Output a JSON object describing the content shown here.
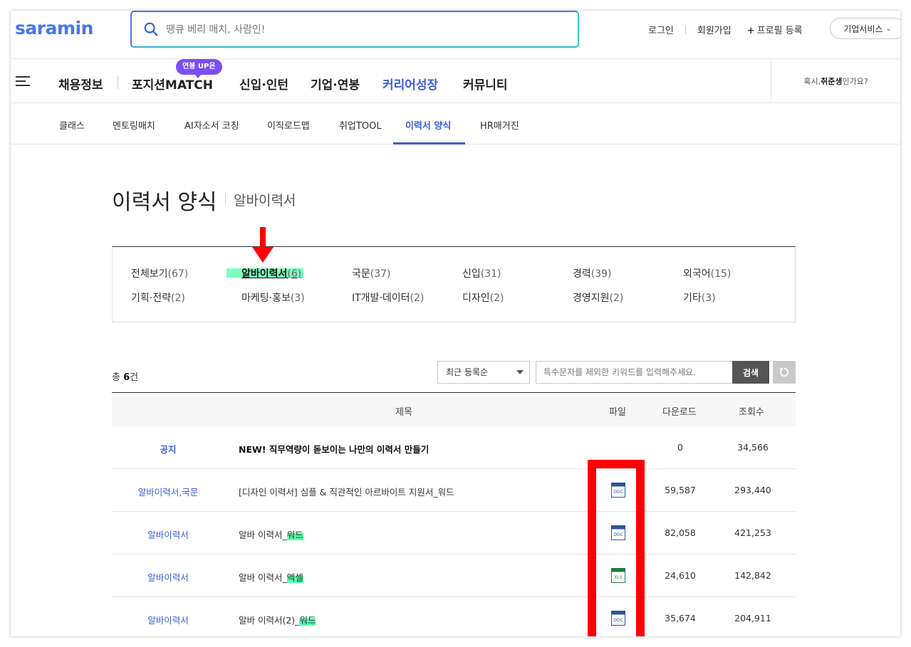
{
  "header": {
    "logo": "saramin",
    "search_placeholder": "땡큐 베리 매치, 사람인!",
    "login": "로그인",
    "signup": "회원가입",
    "profile": "프로필 등록",
    "business": "기업서비스"
  },
  "gnb": {
    "items": [
      "채용정보",
      "포지션",
      "MATCH",
      "신입·인턴",
      "기업·연봉",
      "커리어성장",
      "커뮤니티"
    ],
    "badge": "연봉 UP은",
    "right_prefix": "혹시,",
    "right_bold": "취준생",
    "right_suffix": "인가요?"
  },
  "subnav": {
    "items": [
      "클래스",
      "멘토링매치",
      "AI자소서 코칭",
      "이직로드맵",
      "취업TOOL",
      "이력서 양식",
      "HR매거진"
    ],
    "active": "이력서 양식"
  },
  "page": {
    "title": "이력서 양식",
    "subtitle": "알바이력서"
  },
  "categories": [
    {
      "name": "전체보기",
      "count": "(67)"
    },
    {
      "name": "알바이력서",
      "count": "(6)"
    },
    {
      "name": "국문",
      "count": "(37)"
    },
    {
      "name": "신입",
      "count": "(31)"
    },
    {
      "name": "경력",
      "count": "(39)"
    },
    {
      "name": "외국어",
      "count": "(15)"
    },
    {
      "name": "기획·전략",
      "count": "(2)"
    },
    {
      "name": "마케팅·홍보",
      "count": "(3)"
    },
    {
      "name": "IT개발·데이터",
      "count": "(2)"
    },
    {
      "name": "디자인",
      "count": "(2)"
    },
    {
      "name": "경영지원",
      "count": "(2)"
    },
    {
      "name": "기타",
      "count": "(3)"
    }
  ],
  "toolbar": {
    "total_prefix": "총 ",
    "total_count": "6",
    "total_suffix": "건",
    "sort": "최근 등록순",
    "keyword_placeholder": "특수문자를 제외한 키워드를 입력해주세요.",
    "search_button": "검색"
  },
  "table": {
    "headers": [
      "제목",
      "파일",
      "다운로드",
      "조회수"
    ],
    "rows": [
      {
        "category": "공지",
        "title": "NEW! 직무역량이 돋보이는 나만의 이력서 만들기",
        "title_mark": "",
        "file": "",
        "downloads": "0",
        "views": "34,566"
      },
      {
        "category": "알바이력서,국문",
        "title": "[디자인 이력서] 심플 & 직관적인 아르바이트 지원서_워드",
        "title_mark": "",
        "file": "DOC",
        "downloads": "59,587",
        "views": "293,440"
      },
      {
        "category": "알바이력서",
        "title": "알바 이력서_",
        "title_mark": "워드",
        "file": "DOC",
        "downloads": "82,058",
        "views": "421,253"
      },
      {
        "category": "알바이력서",
        "title": "알바 이력서_",
        "title_mark": "엑셀",
        "file": "XLS",
        "downloads": "24,610",
        "views": "142,842"
      },
      {
        "category": "알바이력서",
        "title": "알바 이력서(2)_",
        "title_mark": "워드",
        "file": "DOC",
        "downloads": "35,674",
        "views": "204,911"
      }
    ]
  },
  "colors": {
    "brand": "#4876ef",
    "active": "#3c5fd8",
    "badge": "#7b4df6",
    "annotation": "#ff0000",
    "highlight": "#4dffa8",
    "doc_icon": "#2a5599",
    "xls_icon": "#1f7a3d"
  }
}
